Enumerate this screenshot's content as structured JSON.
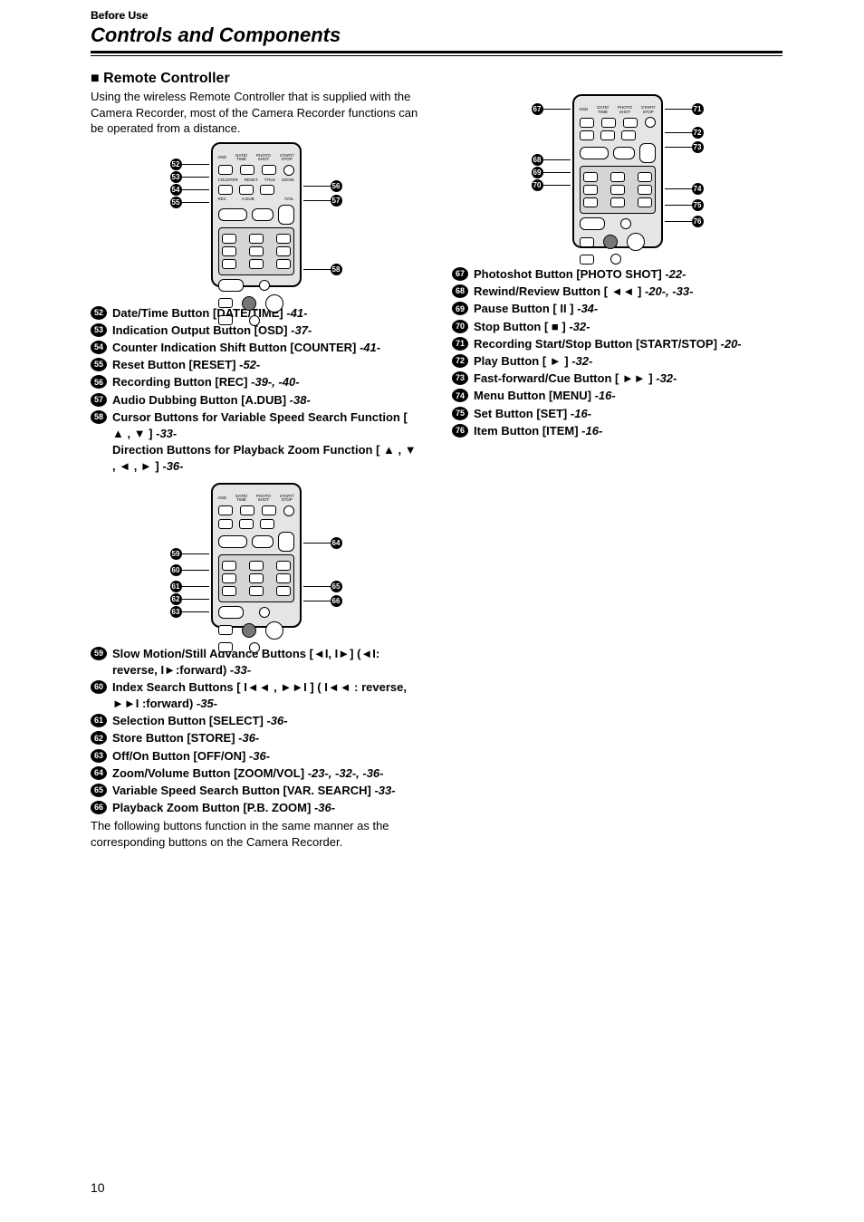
{
  "header": {
    "section": "Before Use",
    "title": "Controls and Components"
  },
  "subhead": "■ Remote Controller",
  "intro": "Using the wireless Remote Controller that is supplied with the Camera Recorder, most of the Camera Recorder functions can be operated from a distance.",
  "left_fig1_callouts": [
    "52",
    "53",
    "54",
    "55",
    "56",
    "57",
    "58"
  ],
  "left_fig2_callouts": [
    "59",
    "60",
    "61",
    "62",
    "63",
    "64",
    "65",
    "66"
  ],
  "right_fig_callouts": [
    "67",
    "68",
    "69",
    "70",
    "71",
    "72",
    "73",
    "74",
    "75",
    "76"
  ],
  "left_items1": [
    {
      "n": "52",
      "label": "Date/Time Button [DATE/TIME]",
      "ref": "-41-"
    },
    {
      "n": "53",
      "label": "Indication Output Button [OSD]",
      "ref": "-37-"
    },
    {
      "n": "54",
      "label": "Counter Indication Shift Button [COUNTER]",
      "ref": "-41-"
    },
    {
      "n": "55",
      "label": "Reset Button [RESET]",
      "ref": "-52-"
    },
    {
      "n": "56",
      "label": "Recording Button [REC]",
      "ref": "-39-, -40-"
    },
    {
      "n": "57",
      "label": "Audio Dubbing Button [A.DUB]",
      "ref": "-38-"
    },
    {
      "n": "58",
      "label": "Cursor Buttons for Variable Speed Search Function [ ▲ , ▼ ]",
      "ref": "-33-",
      "sub": "Direction Buttons for Playback Zoom Function [ ▲ , ▼ , ◄ , ► ]",
      "subref": "-36-"
    }
  ],
  "left_items2": [
    {
      "n": "59",
      "label": "Slow Motion/Still Advance Buttons [◄I, I►] (◄I: reverse, I►:forward)",
      "ref": "-33-"
    },
    {
      "n": "60",
      "label": "Index Search Buttons [ I◄◄ , ►►I ] ( I◄◄ : reverse, ►►I :forward)",
      "ref": "-35-"
    },
    {
      "n": "61",
      "label": "Selection Button [SELECT]",
      "ref": "-36-"
    },
    {
      "n": "62",
      "label": "Store Button [STORE]",
      "ref": "-36-"
    },
    {
      "n": "63",
      "label": "Off/On Button [OFF/ON]",
      "ref": "-36-"
    },
    {
      "n": "64",
      "label": "Zoom/Volume Button [ZOOM/VOL]",
      "ref": "-23-, -32-, -36-"
    },
    {
      "n": "65",
      "label": "Variable Speed Search Button [VAR. SEARCH]",
      "ref": "-33-"
    },
    {
      "n": "66",
      "label": "Playback Zoom Button [P.B. ZOOM]",
      "ref": "-36-"
    }
  ],
  "closing": "The following buttons function in the same manner as the corresponding buttons on the Camera Recorder.",
  "right_items": [
    {
      "n": "67",
      "label": "Photoshot Button [PHOTO SHOT]",
      "ref": "-22-"
    },
    {
      "n": "68",
      "label": "Rewind/Review Button [ ◄◄ ]",
      "ref": "-20-, -33-"
    },
    {
      "n": "69",
      "label": "Pause Button [ II ]",
      "ref": "-34-"
    },
    {
      "n": "70",
      "label": "Stop Button [ ■ ]",
      "ref": "-32-"
    },
    {
      "n": "71",
      "label": "Recording Start/Stop Button [START/STOP]",
      "ref": "-20-"
    },
    {
      "n": "72",
      "label": "Play Button [ ► ]",
      "ref": "-32-"
    },
    {
      "n": "73",
      "label": "Fast-forward/Cue Button [ ►► ]",
      "ref": "-32-"
    },
    {
      "n": "74",
      "label": "Menu Button [MENU]",
      "ref": "-16-"
    },
    {
      "n": "75",
      "label": "Set Button [SET]",
      "ref": "-16-"
    },
    {
      "n": "76",
      "label": "Item Button [ITEM]",
      "ref": "-16-"
    }
  ],
  "page_number": "10"
}
